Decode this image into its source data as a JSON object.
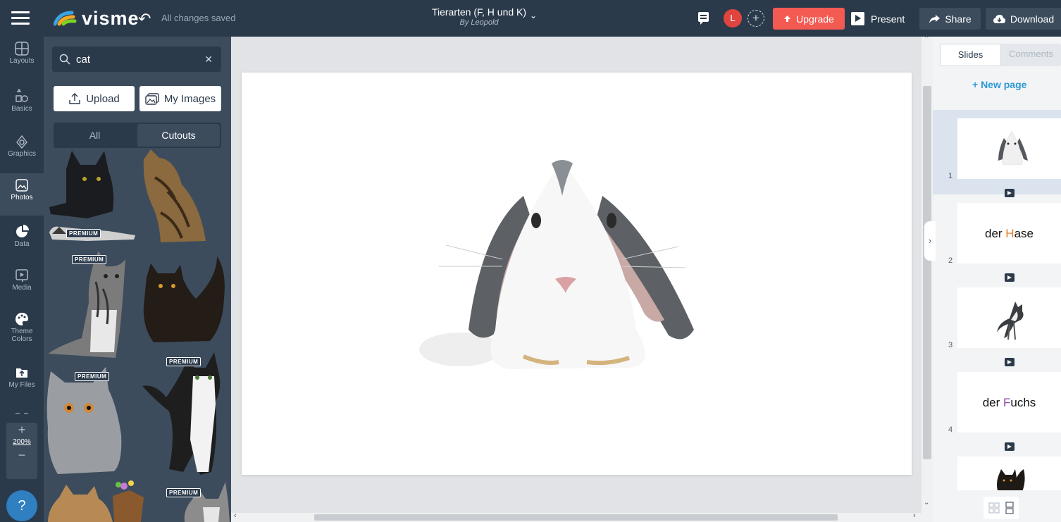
{
  "app": {
    "name": "visme",
    "save_status": "All changes saved"
  },
  "document": {
    "title": "Tierarten (F, H und K)",
    "author": "By Leopold"
  },
  "header": {
    "user_initial": "L",
    "upgrade_label": "Upgrade",
    "present_label": "Present",
    "share_label": "Share",
    "download_label": "Download"
  },
  "leftnav": {
    "items": [
      {
        "label": "Layouts",
        "icon": "layouts-icon"
      },
      {
        "label": "Basics",
        "icon": "basics-icon"
      },
      {
        "label": "Graphics",
        "icon": "graphics-icon"
      },
      {
        "label": "Photos",
        "icon": "photos-icon"
      },
      {
        "label": "Data",
        "icon": "pie-chart-icon"
      },
      {
        "label": "Media",
        "icon": "media-icon"
      },
      {
        "label": "Theme Colors",
        "icon": "palette-icon"
      },
      {
        "label": "My Files",
        "icon": "my-files-icon"
      }
    ],
    "zoom_level": "200%",
    "help_label": "?"
  },
  "panel": {
    "search_value": "cat",
    "upload_label": "Upload",
    "my_images_label": "My Images",
    "tabs": [
      "All",
      "Cutouts"
    ],
    "active_tab": "Cutouts",
    "premium_label": "PREMIUM"
  },
  "slides_panel": {
    "tabs": [
      "Slides",
      "Comments"
    ],
    "new_page_label": "+ New page",
    "slides": [
      {
        "number": "1",
        "type": "image",
        "label": ""
      },
      {
        "number": "2",
        "type": "text",
        "label_pre": "der ",
        "label_hl": "H",
        "label_post": "ase"
      },
      {
        "number": "3",
        "type": "image",
        "label": ""
      },
      {
        "number": "4",
        "type": "text",
        "label_pre": "der ",
        "label_hl": "F",
        "label_post": "uchs"
      }
    ]
  },
  "colors": {
    "dark_bg": "#2b3a4b",
    "panel_bg": "#3c4c5d",
    "upgrade": "#f25a52",
    "accent_blue": "#2f9ad3"
  }
}
